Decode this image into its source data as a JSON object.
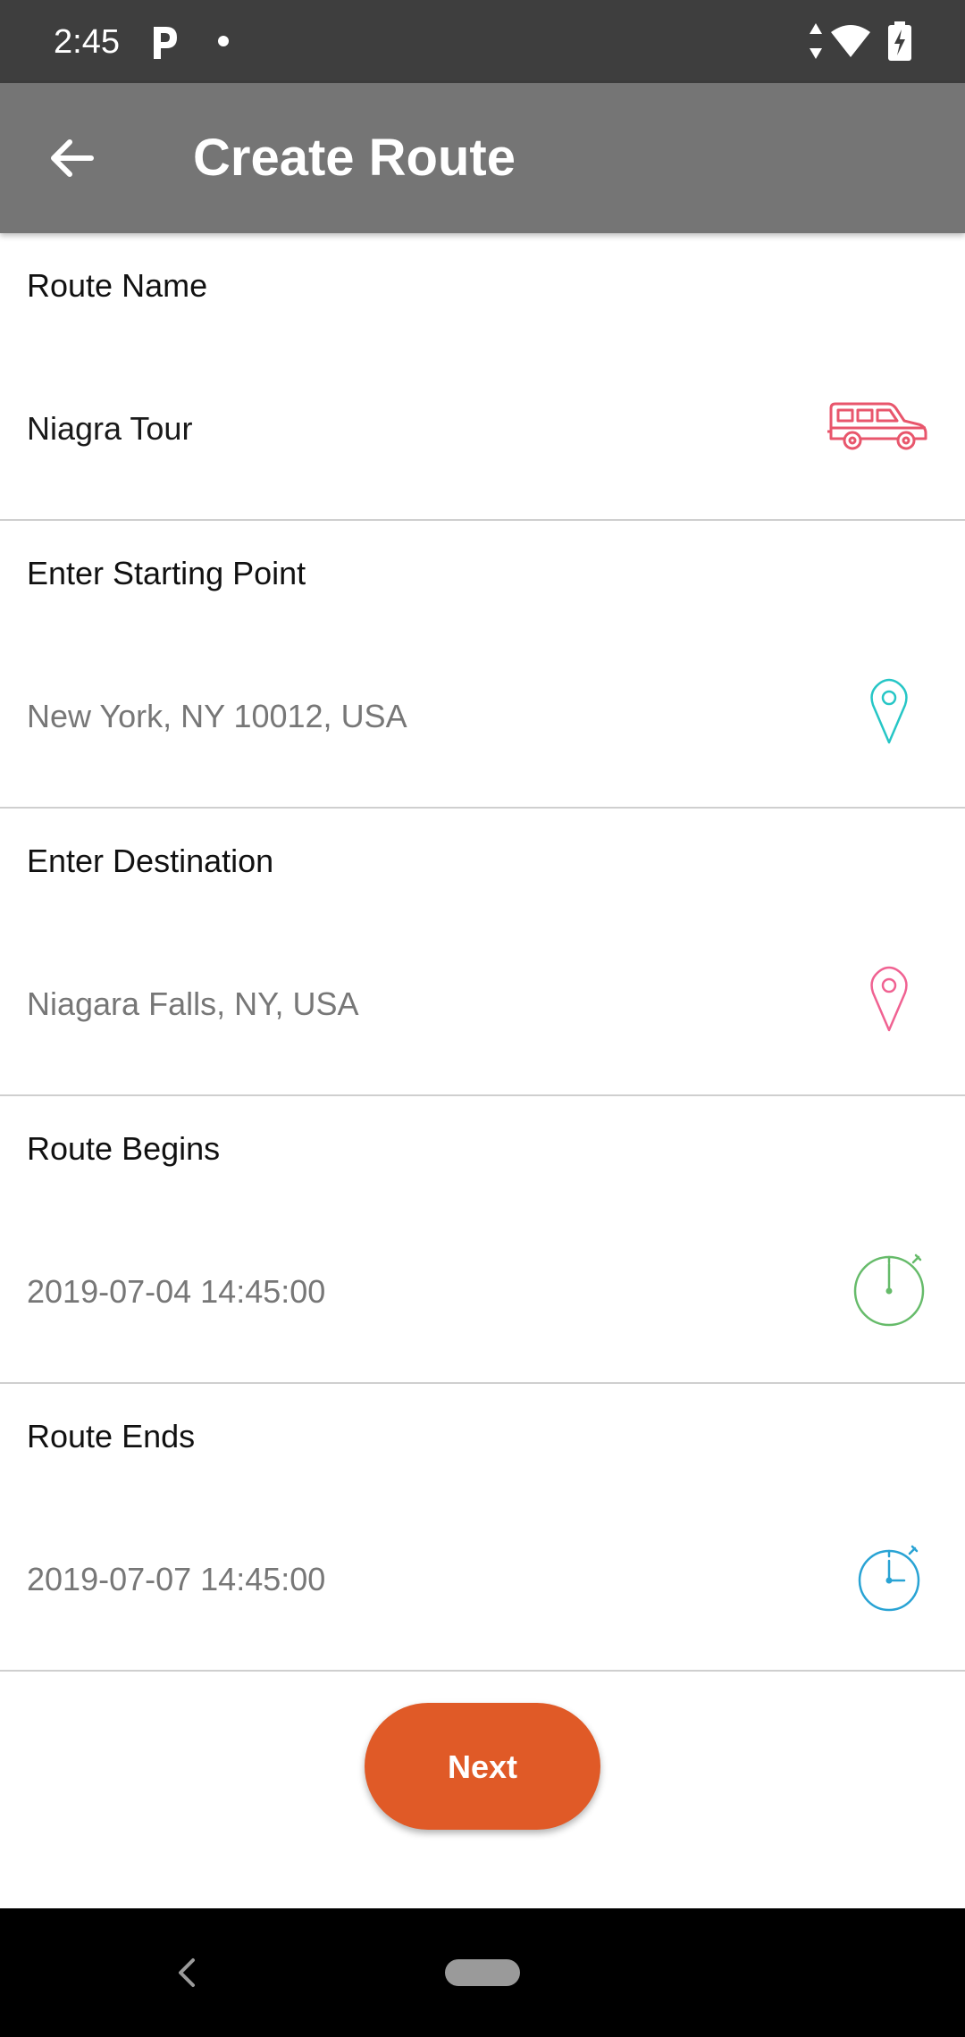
{
  "status_bar": {
    "time": "2:45"
  },
  "app_bar": {
    "title": "Create Route",
    "back_icon": "arrow-left-icon"
  },
  "fields": [
    {
      "label": "Route Name",
      "value": "Niagra Tour",
      "icon": "car-icon",
      "icon_color": "#e8566c"
    },
    {
      "label": "Enter Starting Point",
      "placeholder": "New York, NY 10012, USA",
      "icon": "map-pin-icon",
      "icon_color": "#26c6c6"
    },
    {
      "label": "Enter Destination",
      "placeholder": "Niagara Falls, NY, USA",
      "icon": "map-pin-icon",
      "icon_color": "#f06292"
    },
    {
      "label": "Route Begins",
      "value": "2019-07-04 14:45:00",
      "icon": "stopwatch-icon",
      "icon_color": "#66bb6a"
    },
    {
      "label": "Route Ends",
      "value": "2019-07-07 14:45:00",
      "icon": "stopwatch-icon",
      "icon_color": "#29a3d4"
    }
  ],
  "actions": {
    "next_label": "Next",
    "next_color": "#e05a27"
  }
}
